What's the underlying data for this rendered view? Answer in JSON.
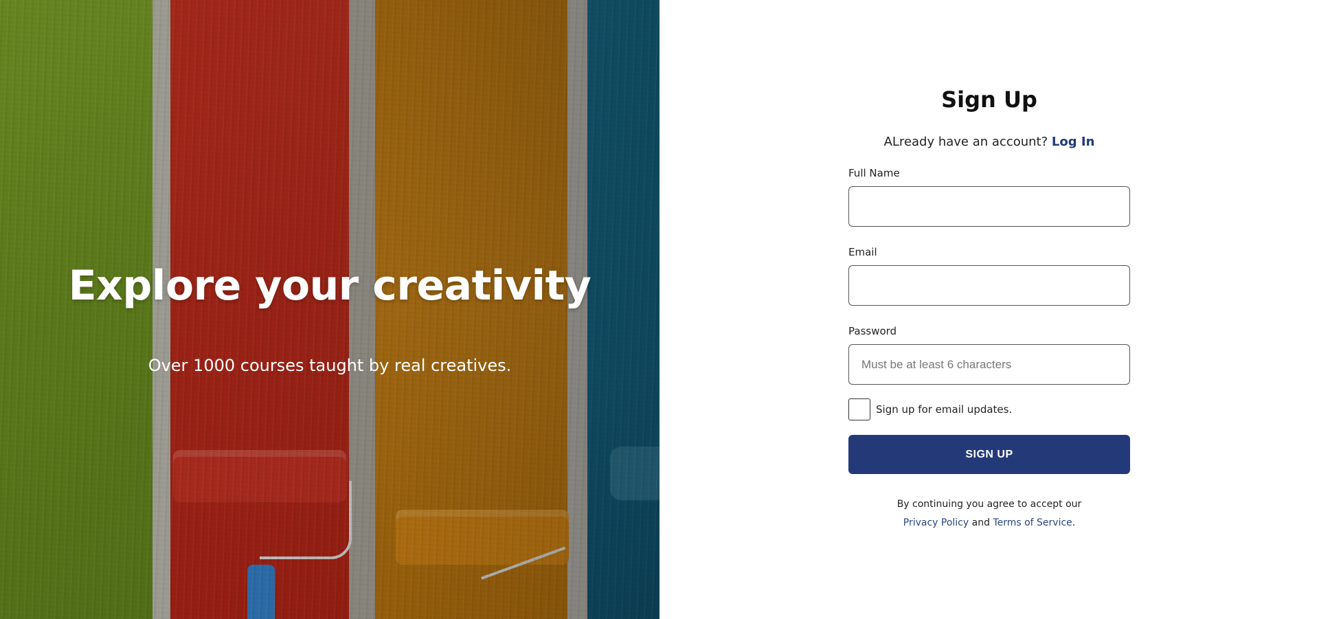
{
  "hero": {
    "title": "Explore your creativity",
    "subtitle": "Over 1000 courses taught by real creatives."
  },
  "form": {
    "title": "Sign Up",
    "login_prompt": "ALready have an account?",
    "login_link": "Log In",
    "full_name": {
      "label": "Full Name",
      "value": "",
      "placeholder": ""
    },
    "email": {
      "label": "Email",
      "value": "",
      "placeholder": ""
    },
    "password": {
      "label": "Password",
      "value": "",
      "placeholder": "Must be at least 6 characters"
    },
    "email_updates": {
      "label": "Sign up for email updates.",
      "checked": false
    },
    "submit_label": "SIGN UP",
    "legal": {
      "prefix": "By continuing you agree to accept our",
      "privacy": "Privacy Policy",
      "and": "and",
      "terms": "Terms of Service",
      "suffix": "."
    }
  },
  "colors": {
    "primary_button": "#243a78",
    "link": "#1d3a78"
  }
}
